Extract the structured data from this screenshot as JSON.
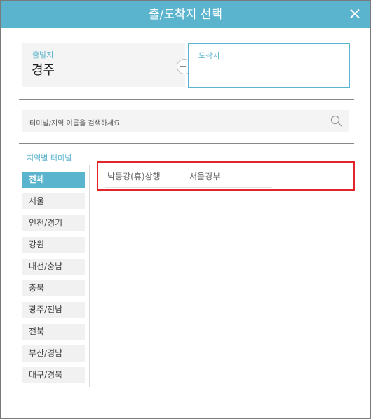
{
  "header": {
    "title": "출/도착지 선택"
  },
  "origin": {
    "label": "출발지",
    "value": "경주"
  },
  "destination": {
    "label": "도착지",
    "value": ""
  },
  "search": {
    "placeholder": "터미널/지역 이름을 검색하세요"
  },
  "regions": {
    "title": "지역별 터미널",
    "items": [
      "전체",
      "서울",
      "인천/경기",
      "강원",
      "대전/충남",
      "충북",
      "광주/전남",
      "전북",
      "부산/경남",
      "대구/경북"
    ],
    "active_index": 0
  },
  "terminals": [
    "낙동강(휴)상행",
    "서울경부"
  ],
  "colors": {
    "accent": "#5bb4cd",
    "highlight": "#e0262b"
  }
}
